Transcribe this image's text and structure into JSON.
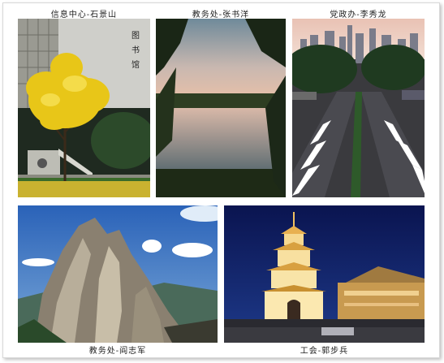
{
  "photos": [
    {
      "caption": "信息中心-石景山"
    },
    {
      "caption": "教务处-张书洋"
    },
    {
      "caption": "党政办-李秀龙"
    },
    {
      "caption": "教务处-阎志军"
    },
    {
      "caption": "工会-郭步兵"
    }
  ],
  "building_sign": "图书馆",
  "colors": {
    "caption_text": "#222222",
    "frame_border": "#d8d8d8",
    "tree_yellow": "#e8c618",
    "night_sky": "#0c1a5a",
    "pagoda_light": "#f0c060"
  }
}
